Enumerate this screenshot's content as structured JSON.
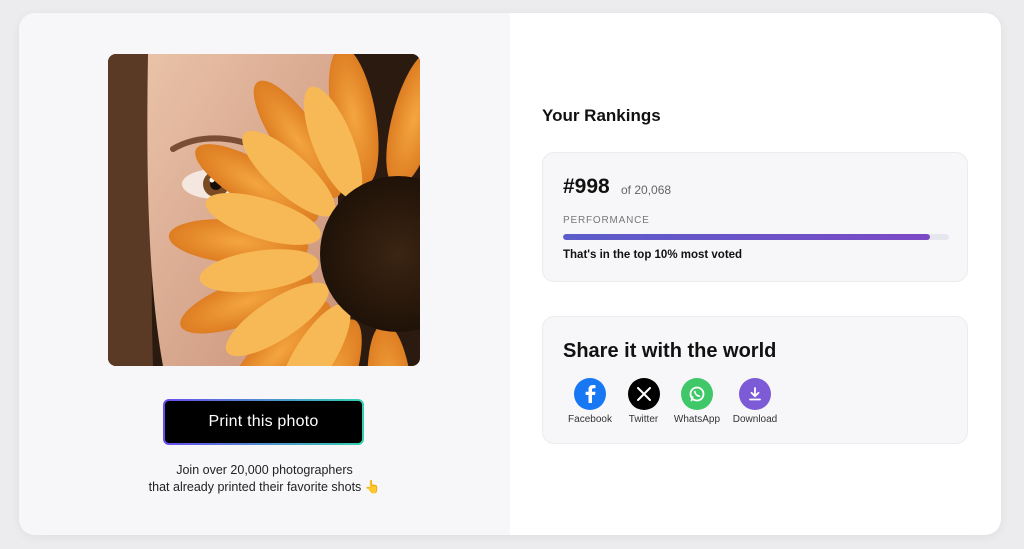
{
  "left": {
    "print_label": "Print this photo",
    "join_line1": "Join over 20,000 photographers",
    "join_line2": "that already printed their favorite shots 👆"
  },
  "rankings": {
    "title": "Your Rankings",
    "rank": "#998",
    "of_total": "of 20,068",
    "performance_label": "PERFORMANCE",
    "performance_fraction": 0.95,
    "performance_text": "That's in the top 10% most voted"
  },
  "share": {
    "title": "Share it with the world",
    "items": [
      {
        "label": "Facebook",
        "icon": "facebook-icon",
        "color": "#1877f2"
      },
      {
        "label": "Twitter",
        "icon": "x-icon",
        "color": "#000000"
      },
      {
        "label": "WhatsApp",
        "icon": "whatsapp-icon",
        "color": "#3fc768"
      },
      {
        "label": "Download",
        "icon": "download-icon",
        "color": "#7d5bd6"
      }
    ]
  },
  "colors": {
    "accent_gradient_start": "#6a4cf0",
    "accent_gradient_end": "#35d0b0",
    "bar_fill": "#6a55c8"
  }
}
